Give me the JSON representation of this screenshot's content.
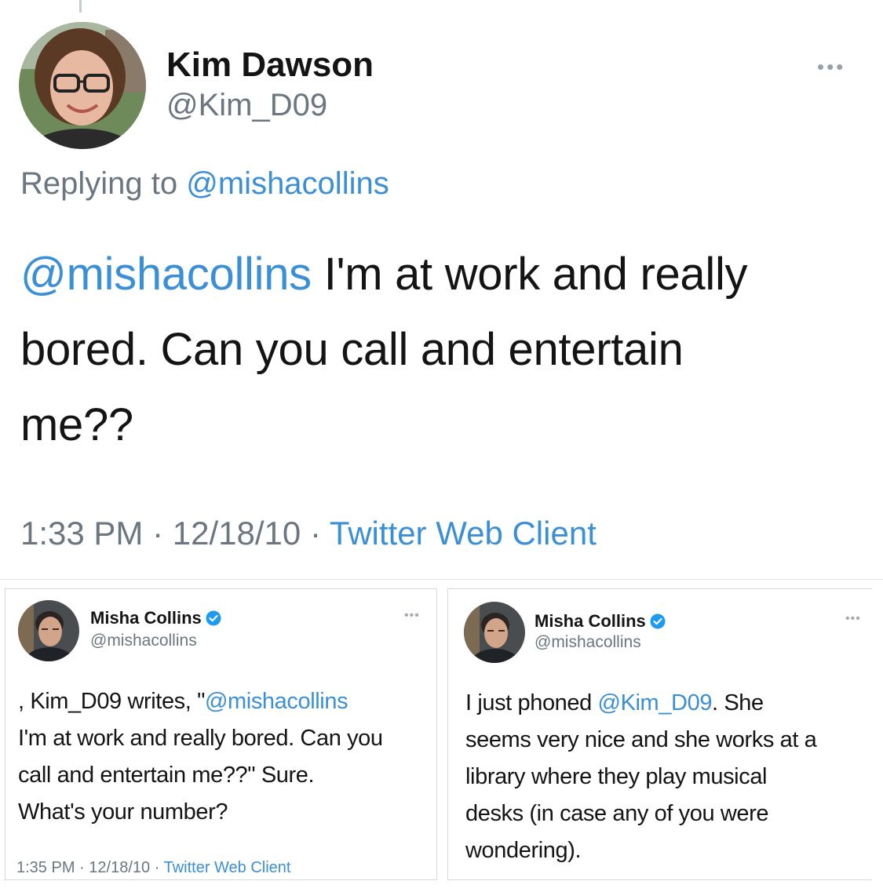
{
  "main_tweet": {
    "author_name": "Kim Dawson",
    "author_handle": "@Kim_D09",
    "more_icon": "more-horizontal-icon",
    "reply_prefix": "Replying to",
    "reply_to": "@mishacollins",
    "body": {
      "mention": "@mishacollins",
      "line1_rest": " I'm at work and really",
      "line2": "bored. Can you call and entertain",
      "line3": "me??"
    },
    "time": "1:33 PM",
    "date": "12/18/10",
    "separator": "·",
    "source": "Twitter Web Client"
  },
  "tweet_left": {
    "author_name": "Misha Collins",
    "author_handle": "@mishacollins",
    "verified_icon": "verified-badge-icon",
    "more_icon": "more-horizontal-icon",
    "body": {
      "line1_pre": ", Kim_D09 writes, \"",
      "line1_mention": "@mishacollins",
      "line2": "I'm at work and really bored. Can you",
      "line3": "call and entertain me??\" Sure.",
      "line4": "What's your number?"
    },
    "time": "1:35 PM",
    "date": "12/18/10",
    "separator": "·",
    "source": "Twitter Web Client"
  },
  "tweet_right": {
    "author_name": "Misha Collins",
    "author_handle": "@mishacollins",
    "verified_icon": "verified-badge-icon",
    "more_icon": "more-horizontal-icon",
    "body": {
      "line1_pre": "I just phoned ",
      "line1_mention": "@Kim_D09",
      "line1_post": ". She",
      "line2": "seems very nice and she works at a",
      "line3": "library where they play musical",
      "line4": "desks (in case any of you were",
      "line5": "wondering)."
    }
  },
  "colors": {
    "link": "#3b8fd6",
    "secondary_text": "#6b7680",
    "primary_text": "#141414",
    "verified_blue": "#1d9bf0"
  }
}
